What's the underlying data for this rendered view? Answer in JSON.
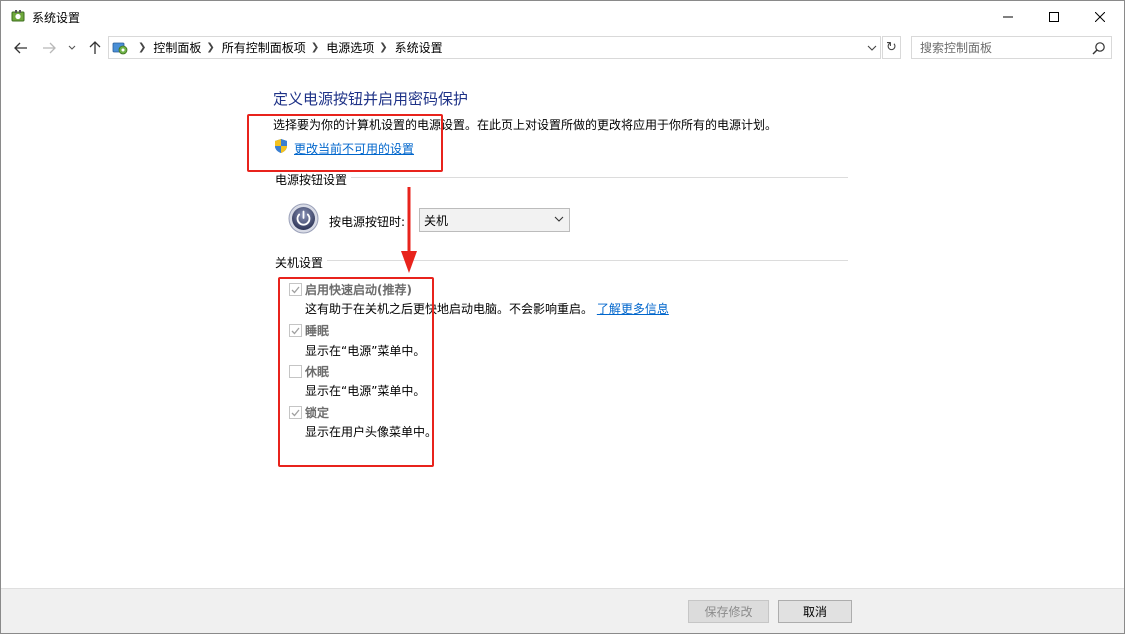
{
  "window": {
    "title": "系统设置"
  },
  "nav": {
    "breadcrumb": [
      "控制面板",
      "所有控制面板项",
      "电源选项",
      "系统设置"
    ],
    "search_placeholder": "搜索控制面板"
  },
  "main": {
    "title": "定义电源按钮并启用密码保护",
    "description": "选择要为你的计算机设置的电源设置。在此页上对设置所做的更改将应用于你所有的电源计划。",
    "change_link": "更改当前不可用的设置",
    "power_button_group": {
      "label": "电源按钮设置",
      "when_pressed_label": "按电源按钮时:",
      "selected_action": "关机"
    },
    "shutdown_group": {
      "label": "关机设置",
      "options": [
        {
          "label": "启用快速启动(推荐)",
          "checked": true,
          "description": "这有助于在关机之后更快地启动电脑。不会影响重启。",
          "link": "了解更多信息"
        },
        {
          "label": "睡眠",
          "checked": true,
          "description": "显示在“电源”菜单中。"
        },
        {
          "label": "休眠",
          "checked": false,
          "description": "显示在“电源”菜单中。"
        },
        {
          "label": "锁定",
          "checked": true,
          "description": "显示在用户头像菜单中。"
        }
      ]
    }
  },
  "footer": {
    "save_label": "保存修改",
    "cancel_label": "取消"
  },
  "colors": {
    "title_blue": "#1e3287",
    "link_blue": "#0066cc",
    "annotation_red": "#e8231c"
  }
}
